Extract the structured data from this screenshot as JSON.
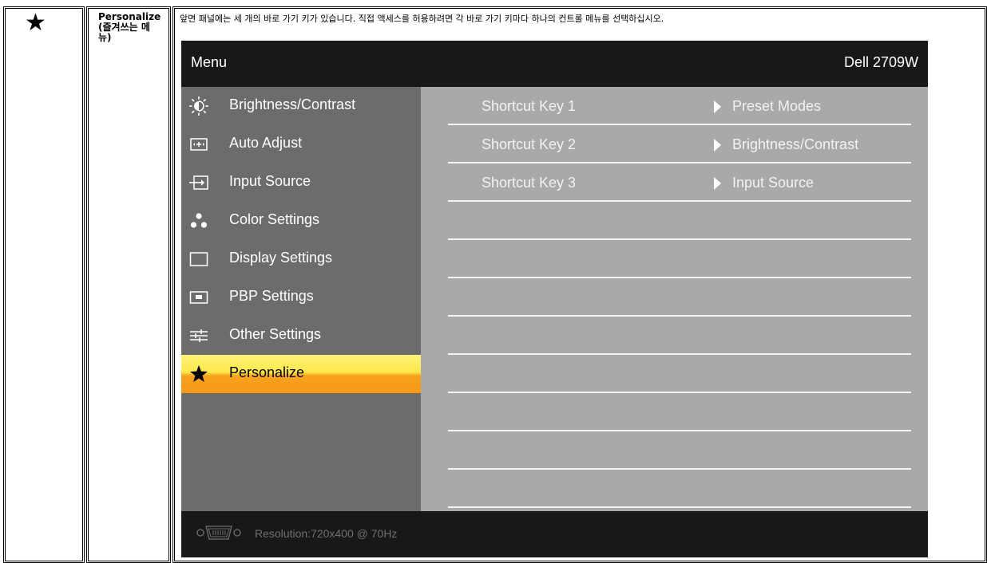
{
  "row": {
    "icon": "star-icon",
    "title_line1": "Personalize",
    "title_line2": "(즐겨쓰는 메",
    "title_line3": "뉴)",
    "description": "앞면 패널에는 세 개의 바로 가기 키가 있습니다. 직접 액세스를 허용하려면 각 바로 가기 키마다 하나의 컨트롤 메뉴를 선택하십시오."
  },
  "osd": {
    "menu_title": "Menu",
    "model": "Dell 2709W",
    "menu_items": [
      {
        "label": "Brightness/Contrast",
        "icon": "brightness-icon"
      },
      {
        "label": "Auto Adjust",
        "icon": "auto-adjust-icon"
      },
      {
        "label": "Input Source",
        "icon": "input-source-icon"
      },
      {
        "label": "Color Settings",
        "icon": "color-settings-icon"
      },
      {
        "label": "Display Settings",
        "icon": "display-settings-icon"
      },
      {
        "label": "PBP Settings",
        "icon": "pbp-settings-icon"
      },
      {
        "label": "Other Settings",
        "icon": "other-settings-icon"
      },
      {
        "label": "Personalize",
        "icon": "star-icon",
        "selected": true
      }
    ],
    "shortcuts": [
      {
        "key": "Shortcut Key 1",
        "value": "Preset Modes"
      },
      {
        "key": "Shortcut Key 2",
        "value": "Brightness/Contrast"
      },
      {
        "key": "Shortcut Key 3",
        "value": "Input Source"
      }
    ],
    "resolution": "Resolution:720x400 @ 70Hz",
    "colors": {
      "header_bg": "#1a1717",
      "left_panel_bg": "#6c6c6c",
      "right_panel_bg": "#a9a9a9",
      "selected_top": "#fff27a",
      "selected_bottom": "#f59a17"
    }
  }
}
